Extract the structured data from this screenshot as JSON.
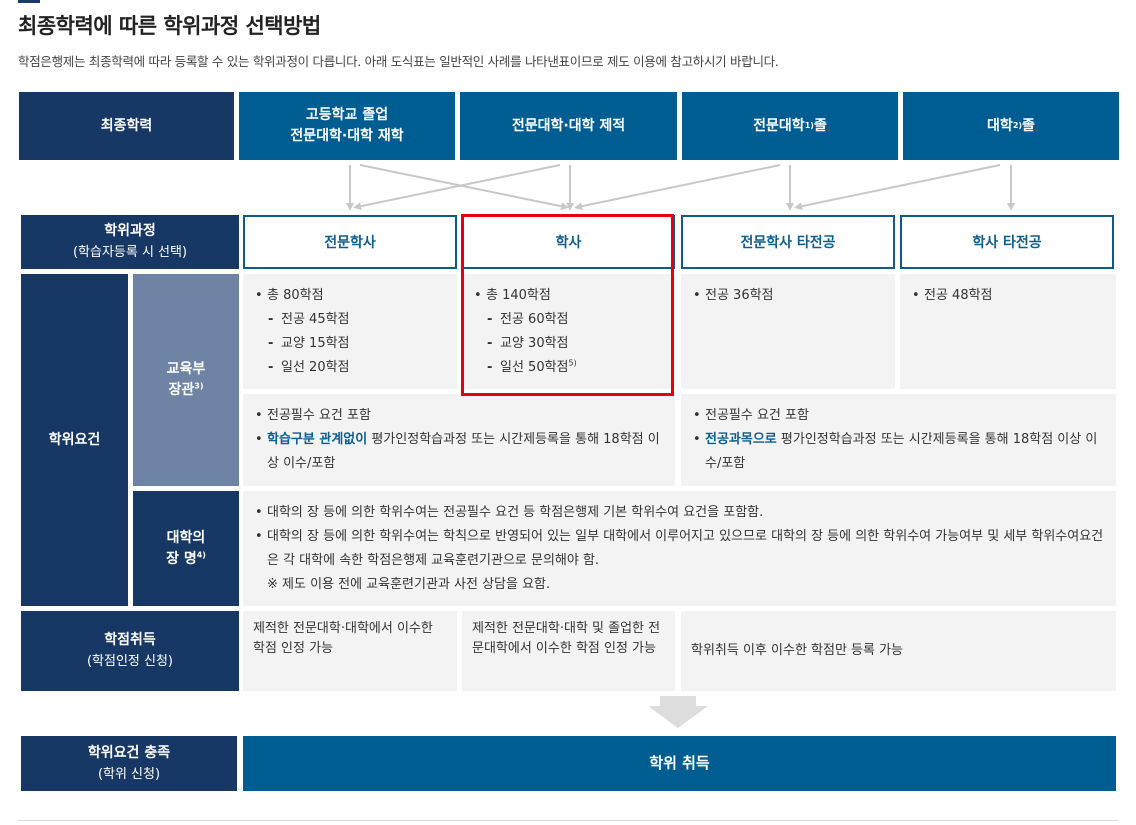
{
  "title": "최종학력에 따른 학위과정 선택방법",
  "description": "학점은행제는 최종학력에 따라 등록할 수 있는 학위과정이 다릅니다. 아래 도식표는 일반적인 사례를 나타낸표이므로 제도 이용에 참고하시기 바랍니다.",
  "header": {
    "label": "최종학력",
    "columns": [
      {
        "line1": "고등학교 졸업",
        "line2": "전문대학·대학 재학"
      },
      {
        "line1": "전문대학·대학 제적"
      },
      {
        "line1": "전문대학",
        "sup": "1)",
        "after": " 졸"
      },
      {
        "line1": "대학",
        "sup": "2)",
        "after": " 졸"
      }
    ]
  },
  "programs": {
    "label": "학위과정",
    "sublabel": "(학습자등록 시 선택)",
    "items": [
      "전문학사",
      "학사",
      "전문학사 타전공",
      "학사 타전공"
    ]
  },
  "requirements": {
    "label": "학위요건",
    "ministry": {
      "label_line1": "교육부",
      "label_line2": "장관",
      "sup": "3)",
      "col1": {
        "total": "총 80학점",
        "items": [
          "전공 45학점",
          "교양 15학점",
          "일선 20학점"
        ]
      },
      "col2": {
        "total": "총 140학점",
        "items": [
          "전공 60학점",
          "교양 30학점",
          "일선 50학점"
        ],
        "last_sup": "5)"
      },
      "col3": {
        "total": "전공 36학점"
      },
      "col4": {
        "total": "전공 48학점"
      },
      "left_notes": {
        "note1": "전공필수 요건 포함",
        "note2_highlight": "학습구분 관계없이",
        "note2_rest": " 평가인정학습과정 또는 시간제등록을 통해 18학점 이상 이수/포함"
      },
      "right_notes": {
        "note1": "전공필수 요건 포함",
        "note2_highlight": "전공과목으로",
        "note2_rest": " 평가인정학습과정 또는 시간제등록을 통해 18학점 이상 이수/포함"
      }
    },
    "university": {
      "label_line1": "대학의",
      "label_line2": "장 명",
      "sup": "4)",
      "notes": [
        "대학의 장 등에 의한 학위수여는 전공필수 요건 등 학점은행제 기본 학위수여 요건을 포함함.",
        "대학의 장 등에 의한 학위수여는 학칙으로 반영되어 있는 일부 대학에서 이루어지고 있으므로 대학의 장 등에 의한 학위수여 가능여부 및 세부 학위수여요건은 각 대학에 속한 학점은행제 교육훈련기관으로 문의해야 함."
      ],
      "footnote": "※ 제도 이용 전에 교육훈련기관과 사전 상담을 요함."
    }
  },
  "credits": {
    "label": "학점취득",
    "sublabel": "(학점인정 신청)",
    "col1": "제적한 전문대학·대학에서 이수한 학점 인정 가능",
    "col2": "제적한 전문대학·대학 및 졸업한 전문대학에서 이수한 학점 인정 가능",
    "col34": "학위취득 이후 이수한 학점만 등록 가능"
  },
  "completion": {
    "label": "학위요건 충족",
    "sublabel": "(학위 신청)",
    "result": "학위 취득"
  },
  "colors": {
    "navy": "#173864",
    "blue": "#005d92",
    "slate": "#6f84a5",
    "highlight_box": "#e60012",
    "panel": "#f3f3f3"
  }
}
